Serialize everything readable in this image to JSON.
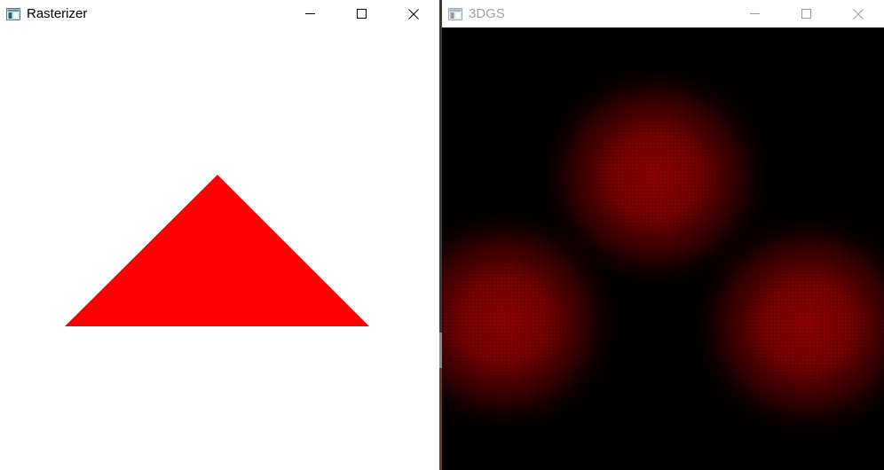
{
  "windows": {
    "rasterizer": {
      "title": "Rasterizer",
      "title_color": "#000000",
      "client_background": "#fefefe",
      "shape": {
        "kind": "triangle",
        "fill": "#ff0000"
      },
      "controls": {
        "minimize_icon": "minimize-icon",
        "maximize_icon": "maximize-icon",
        "close_icon": "close-icon"
      }
    },
    "gaussians": {
      "title": "3DGS",
      "title_color": "#a0a0a0",
      "client_background": "#000000",
      "blobs": {
        "count": 3,
        "color": "#8b0000"
      },
      "controls": {
        "minimize_icon": "minimize-icon",
        "maximize_icon": "maximize-icon",
        "close_icon": "close-icon"
      }
    }
  }
}
